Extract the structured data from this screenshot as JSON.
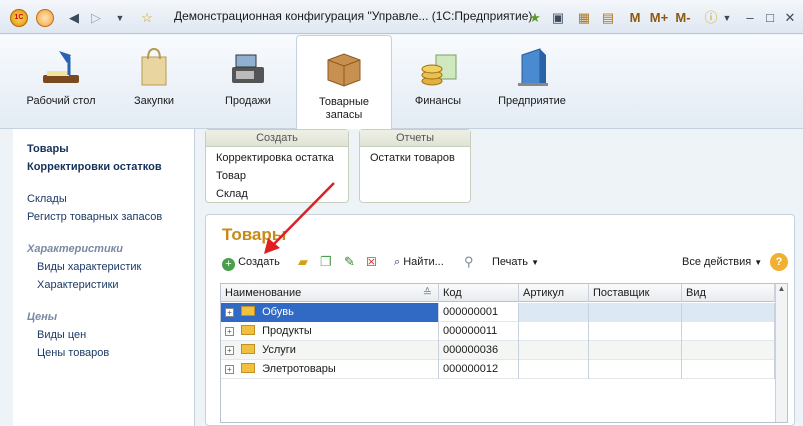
{
  "window": {
    "title": "Демонстрационная конфигурация \"Управле...  (1С:Предприятие)",
    "app_badge": "1С",
    "buttons": {
      "m": "M",
      "m_plus": "M+",
      "m_minus": "M-",
      "minimize": "–",
      "maximize": "□",
      "close": "✕"
    }
  },
  "sections": [
    {
      "label": "Рабочий стол",
      "icon": "desk-lamp-icon"
    },
    {
      "label": "Закупки",
      "icon": "shopping-bag-icon"
    },
    {
      "label": "Продажи",
      "icon": "cash-register-icon"
    },
    {
      "label": "Товарные запасы",
      "icon": "box-icon",
      "active": true
    },
    {
      "label": "Финансы",
      "icon": "coins-icon"
    },
    {
      "label": "Предприятие",
      "icon": "building-icon"
    }
  ],
  "left_panel": {
    "items": [
      {
        "label": "Товары",
        "style": "bold"
      },
      {
        "label": "Корректировки остатков",
        "style": "bold"
      },
      {
        "label": "Склады",
        "style": "normal"
      },
      {
        "label": "Регистр товарных запасов",
        "style": "normal"
      },
      {
        "label": "Характеристики",
        "style": "group"
      },
      {
        "label": "Виды характеристик",
        "style": "normal"
      },
      {
        "label": "Характеристики",
        "style": "normal"
      },
      {
        "label": "Цены",
        "style": "group"
      },
      {
        "label": "Виды цен",
        "style": "normal"
      },
      {
        "label": "Цены товаров",
        "style": "normal"
      }
    ]
  },
  "create_box": {
    "header": "Создать",
    "commands": [
      "Корректировка остатка",
      "Товар",
      "Склад"
    ]
  },
  "reports_box": {
    "header": "Отчеты",
    "commands": [
      "Остатки товаров"
    ]
  },
  "main": {
    "title": "Товары",
    "toolbar": {
      "create": "Создать",
      "find": "Найти...",
      "print": "Печать",
      "all_actions": "Все действия",
      "help": "?"
    },
    "table": {
      "columns": [
        "Наименование",
        "Код",
        "Артикул",
        "Поставщик",
        "Вид"
      ],
      "rows": [
        {
          "name": "Обувь",
          "code": "000000001",
          "selected": true
        },
        {
          "name": "Продукты",
          "code": "000000011"
        },
        {
          "name": "Услуги",
          "code": "000000036"
        },
        {
          "name": "Элетротовары",
          "code": "000000012"
        }
      ]
    }
  },
  "colors": {
    "accent_title": "#c88a16",
    "selected_row": "#316ac5",
    "arrow": "#e02020"
  }
}
